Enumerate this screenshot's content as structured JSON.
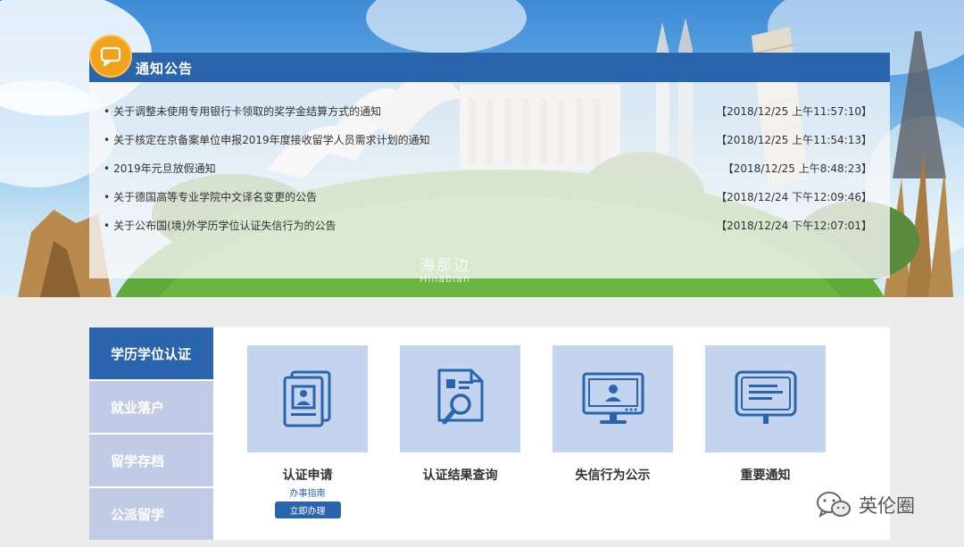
{
  "notice": {
    "title": "通知公告",
    "items": [
      {
        "bullet": "•",
        "title": "关于调整未使用专用银行卡领取的奖学金结算方式的通知",
        "date": "【2018/12/25 上午11:57:10】"
      },
      {
        "bullet": "•",
        "title": "关于核定在京备案单位申报2019年度接收留学人员需求计划的通知",
        "date": "【2018/12/25 上午11:54:13】"
      },
      {
        "bullet": "•",
        "title": "2019年元旦放假通知",
        "date": "【2018/12/25 上午8:48:23】"
      },
      {
        "bullet": "•",
        "title": "关于德国高等专业学院中文译名变更的公告",
        "date": "【2018/12/24 下午12:09:46】"
      },
      {
        "bullet": "•",
        "title": "关于公布国(境)外学历学位认证失信行为的公告",
        "date": "【2018/12/24 下午12:07:01】"
      }
    ]
  },
  "watermark": {
    "main": "海那边",
    "sub": "Hinabian"
  },
  "side_tabs": [
    {
      "label": "学历学位认证",
      "active": true
    },
    {
      "label": "就业落户",
      "active": false
    },
    {
      "label": "留学存档",
      "active": false
    },
    {
      "label": "公派留学",
      "active": false
    }
  ],
  "tiles": [
    {
      "label": "认证申请",
      "sub": "办事指南",
      "button": "立即办理",
      "icon": "certificate-document-icon"
    },
    {
      "label": "认证结果查询",
      "icon": "document-search-icon"
    },
    {
      "label": "失信行为公示",
      "icon": "monitor-user-icon"
    },
    {
      "label": "重要通知",
      "icon": "notice-board-icon"
    }
  ],
  "brand": {
    "text": "英伦圈",
    "icon": "wechat-icon"
  },
  "colors": {
    "primary": "#2a64ad",
    "tile_bg": "#c4d4ee",
    "tab_inactive": "#c1cbe6",
    "badge": "#f2a21c"
  }
}
